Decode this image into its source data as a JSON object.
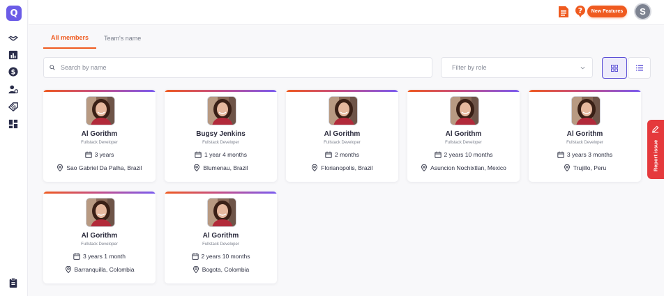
{
  "app": {
    "logo_letter": "Q",
    "accent": "#6b5ce7",
    "brand_orange": "#ef5a1f"
  },
  "sidebar": {
    "items": [
      {
        "icon": "handshake-icon"
      },
      {
        "icon": "bar-chart-icon"
      },
      {
        "icon": "dollar-icon"
      },
      {
        "icon": "user-settings-icon"
      },
      {
        "icon": "tag-icon"
      },
      {
        "icon": "dashboard-icon"
      }
    ],
    "bottom_icon": "clipboard-icon"
  },
  "topbar": {
    "new_features_label": "New Features",
    "user_initial": "S"
  },
  "tabs": [
    {
      "label": "All members",
      "active": true
    },
    {
      "label": "Team's name",
      "active": false
    }
  ],
  "search": {
    "placeholder": "Search by name"
  },
  "filter": {
    "placeholder": "Filter by role"
  },
  "members": [
    {
      "name": "Al Gorithm",
      "role": "Fullstack Developer",
      "experience": "3 years",
      "location": "Sao Gabriel Da Palha, Brazil"
    },
    {
      "name": "Bugsy Jenkins",
      "role": "Fullstack Developer",
      "experience": "1 year 4 months",
      "location": "Blumenau, Brazil"
    },
    {
      "name": "Al Gorithm",
      "role": "Fullstack Developer",
      "experience": "2 months",
      "location": "Florianopolis, Brazil"
    },
    {
      "name": "Al Gorithm",
      "role": "Fullstack Developer",
      "experience": "2 years 10 months",
      "location": "Asuncion Nochixtlan, Mexico"
    },
    {
      "name": "Al Gorithm",
      "role": "Fullstack Developer",
      "experience": "3 years 3 months",
      "location": "Trujillo, Peru"
    },
    {
      "name": "Al Gorithm",
      "role": "Fullstack Developer",
      "experience": "3 years 1 month",
      "location": "Barranquilla, Colombia"
    },
    {
      "name": "Al Gorithm",
      "role": "Fullstack Developer",
      "experience": "2 years 10 months",
      "location": "Bogota, Colombia"
    }
  ],
  "report": {
    "label": "Report issue"
  }
}
